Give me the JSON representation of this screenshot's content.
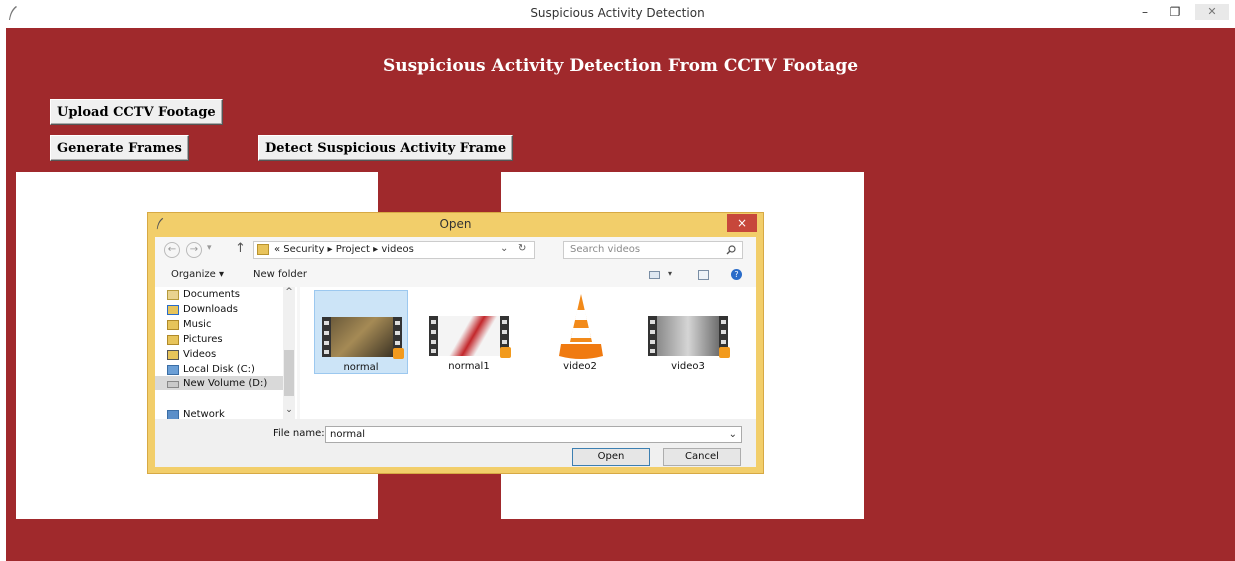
{
  "window": {
    "title": "Suspicious Activity Detection",
    "minimize": "–",
    "maximize": "❐",
    "close": "✕"
  },
  "app": {
    "heading": "Suspicious Activity Detection From CCTV Footage",
    "buttons": {
      "upload": "Upload CCTV Footage",
      "generate": "Generate Frames",
      "detect": "Detect Suspicious Activity Frame"
    }
  },
  "colors": {
    "background": "#a0292c",
    "dialog_frame": "#f2ce6a",
    "selection": "#cce4f7"
  },
  "dialog": {
    "title": "Open",
    "close": "×",
    "nav": {
      "back": "←",
      "forward": "→",
      "recent": "▾",
      "up": "↑"
    },
    "address": {
      "path": "« Security ▸ Project ▸ videos",
      "dropdown": "⌄",
      "refresh": "↻"
    },
    "search": {
      "placeholder": "Search videos",
      "icon": "search-icon"
    },
    "toolbar": {
      "organize": "Organize ▾",
      "new_folder": "New folder",
      "view_arrow": "▾",
      "help": "?"
    },
    "nav_items": [
      {
        "label": "Documents",
        "icon": "documents-icon"
      },
      {
        "label": "Downloads",
        "icon": "downloads-icon"
      },
      {
        "label": "Music",
        "icon": "music-icon"
      },
      {
        "label": "Pictures",
        "icon": "pictures-icon"
      },
      {
        "label": "Videos",
        "icon": "videos-icon"
      },
      {
        "label": "Local Disk (C:)",
        "icon": "local-disk-icon"
      },
      {
        "label": "New Volume (D:)",
        "icon": "drive-icon"
      },
      {
        "label": "Network",
        "icon": "network-icon"
      }
    ],
    "scroll": {
      "up": "^",
      "down": "⌄"
    },
    "files": [
      {
        "name": "normal",
        "selected": true,
        "icon": "video-thumbnail-icon"
      },
      {
        "name": "normal1",
        "selected": false,
        "icon": "video-thumbnail-icon"
      },
      {
        "name": "video2",
        "selected": false,
        "icon": "vlc-cone-icon"
      },
      {
        "name": "video3",
        "selected": false,
        "icon": "video-thumbnail-icon"
      }
    ],
    "filename": {
      "label": "File name:",
      "value": "normal",
      "dropdown": "⌄"
    },
    "open_button": "Open",
    "cancel_button": "Cancel"
  }
}
